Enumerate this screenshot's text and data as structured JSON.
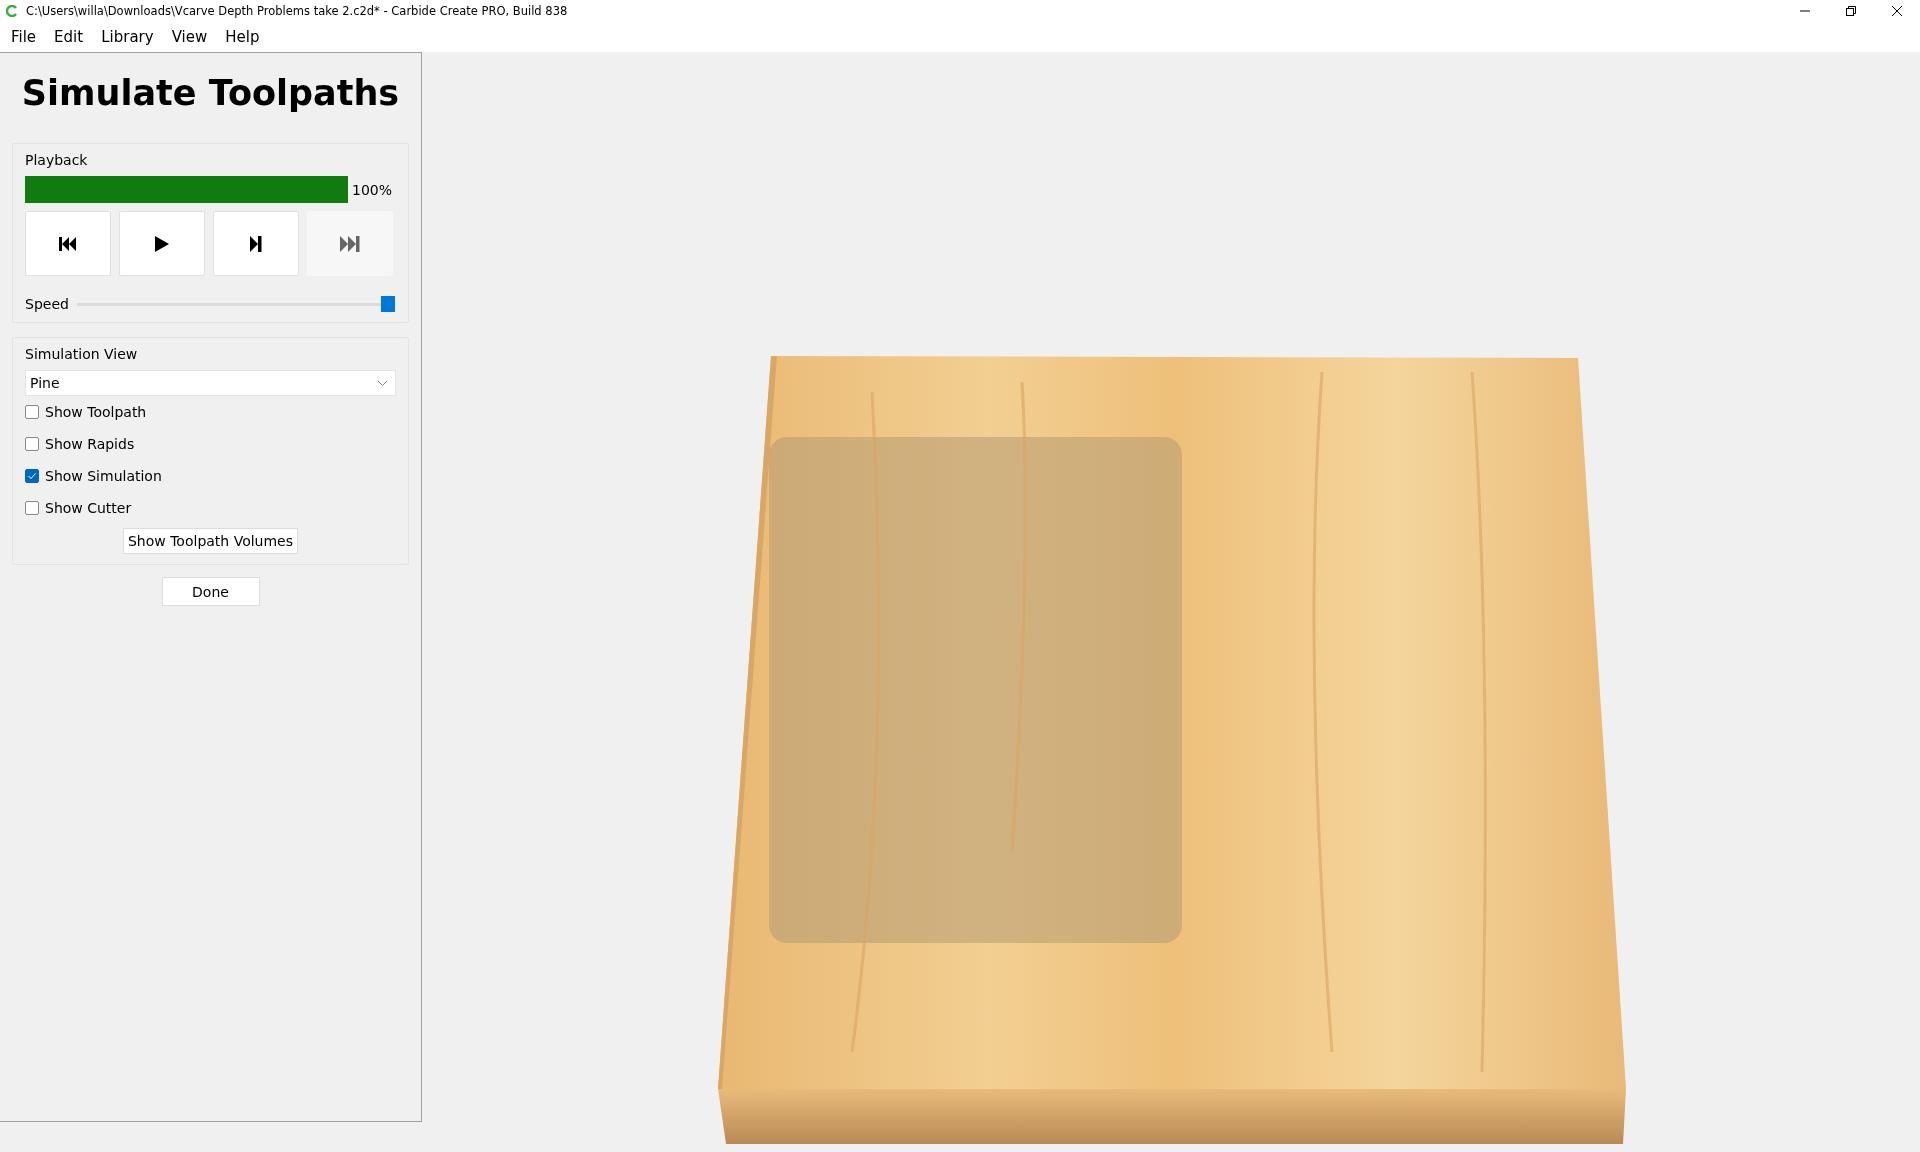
{
  "window": {
    "title": "C:\\Users\\willa\\Downloads\\Vcarve Depth Problems take 2.c2d* - Carbide Create PRO, Build 838"
  },
  "menu": [
    "File",
    "Edit",
    "Library",
    "View",
    "Help"
  ],
  "panel": {
    "title": "Simulate Toolpaths",
    "playback": {
      "label": "Playback",
      "progress": {
        "level": 1,
        "reading": "100%"
      },
      "buttons": [
        {
          "kind": "rewind",
          "disabled": false
        },
        {
          "kind": "play",
          "disabled": false
        },
        {
          "kind": "step",
          "disabled": false
        },
        {
          "kind": "end",
          "disabled": true
        }
      ],
      "speed": {
        "label": "Speed",
        "level": 1
      }
    },
    "simulation_view": {
      "label": "Simulation View",
      "material": "Pine",
      "options": [
        {
          "label": "Show Toolpath",
          "checked": false
        },
        {
          "label": "Show Rapids",
          "checked": false
        },
        {
          "label": "Show Simulation",
          "checked": true
        },
        {
          "label": "Show Cutter",
          "checked": false
        }
      ],
      "volumes_button": "Show Toolpath Volumes"
    },
    "done_button": "Done"
  }
}
